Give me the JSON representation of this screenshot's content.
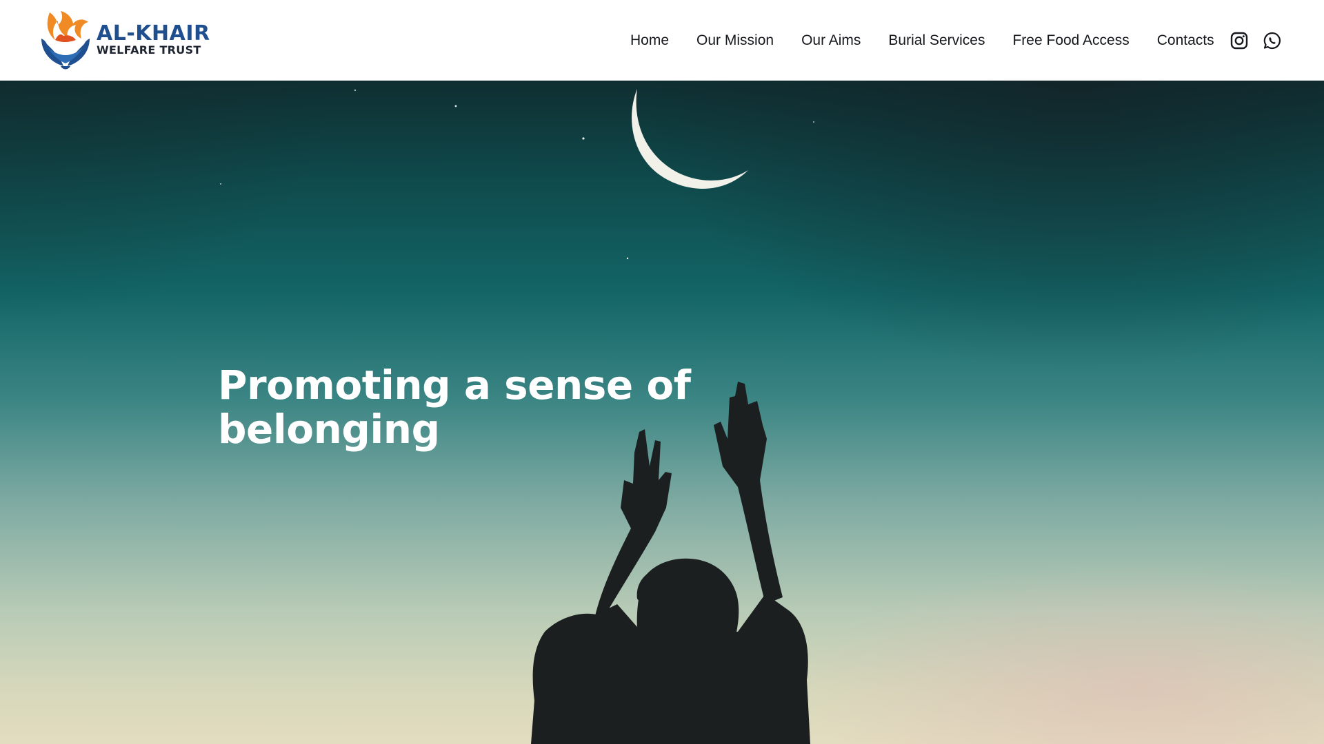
{
  "brand": {
    "name_line1": "AL-KHAIR",
    "name_line2": "WELFARE TRUST",
    "colors": {
      "primary": "#1f4f8f",
      "flame": "#f08a24",
      "text": "#1e2530"
    }
  },
  "nav": {
    "items": [
      {
        "label": "Home"
      },
      {
        "label": "Our Mission"
      },
      {
        "label": "Our Aims"
      },
      {
        "label": "Burial Services"
      },
      {
        "label": "Free Food Access"
      },
      {
        "label": "Contacts"
      }
    ]
  },
  "social": {
    "icons": [
      "instagram-icon",
      "whatsapp-icon"
    ]
  },
  "hero": {
    "title": "Promoting a sense of belonging",
    "image": "crescent-moon-silhouette-raising-hands"
  }
}
